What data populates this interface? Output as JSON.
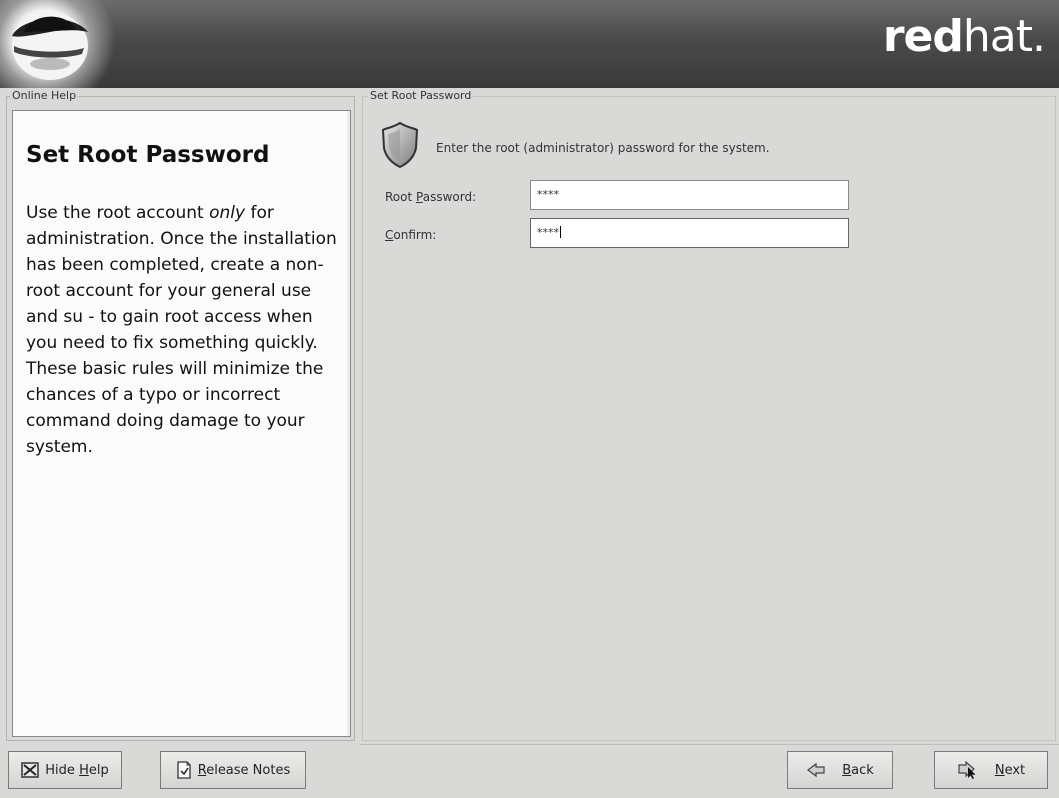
{
  "banner": {
    "brand_bold": "red",
    "brand_rest": "hat."
  },
  "help": {
    "frame_label": "Online Help",
    "title": "Set Root Password",
    "body_before": "Use the root account ",
    "body_emphasis": "only",
    "body_after": " for administration. Once the installation has been completed, create a non-root account for your general use and su - to gain root access when you need to fix something quickly. These basic rules will minimize the chances of a typo or incorrect command doing damage to your system."
  },
  "form": {
    "group_label": "Set Root Password",
    "instruction": "Enter the root (administrator) password for the system.",
    "root_label_prefix": "Root ",
    "root_label_mnemonic": "P",
    "root_label_suffix": "assword:",
    "root_value": "****",
    "confirm_label_mnemonic": "C",
    "confirm_label_suffix": "onfirm:",
    "confirm_value": "****"
  },
  "buttons": {
    "hide_help_prefix": "Hide ",
    "hide_help_mnemonic": "H",
    "hide_help_suffix": "elp",
    "release_notes_mnemonic": "R",
    "release_notes_suffix": "elease Notes",
    "back_mnemonic": "B",
    "back_suffix": "ack",
    "next_mnemonic": "N",
    "next_suffix": "ext"
  }
}
